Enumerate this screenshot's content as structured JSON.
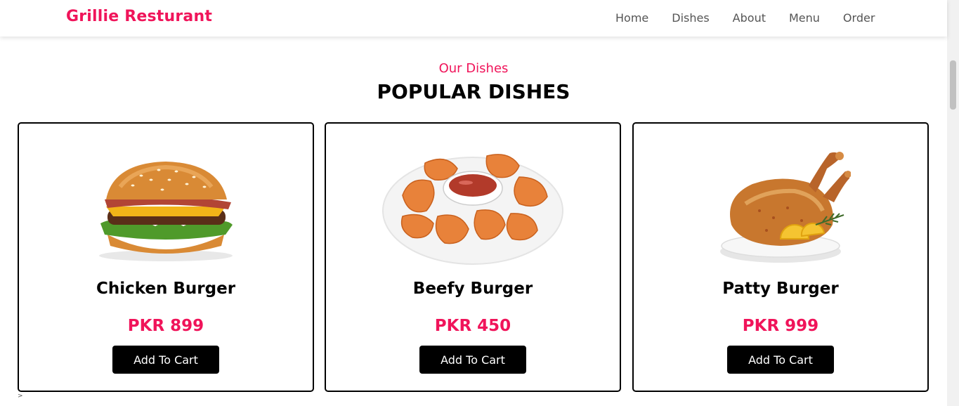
{
  "nav": {
    "brand": "Grillie Resturant",
    "links": [
      "Home",
      "Dishes",
      "About",
      "Menu",
      "Order"
    ]
  },
  "section": {
    "subtitle": "Our Dishes",
    "title": "POPULAR DISHES"
  },
  "cards": [
    {
      "name": "Chicken Burger",
      "price": "PKR 899",
      "button": "Add To Cart",
      "image": "burger-image"
    },
    {
      "name": "Beefy Burger",
      "price": "PKR 450",
      "button": "Add To Cart",
      "image": "nuggets-image"
    },
    {
      "name": "Patty Burger",
      "price": "PKR 999",
      "button": "Add To Cart",
      "image": "roast-chicken-image"
    }
  ],
  "footer_mark": ">",
  "colors": {
    "accent": "#f0145a",
    "button": "#000000"
  }
}
